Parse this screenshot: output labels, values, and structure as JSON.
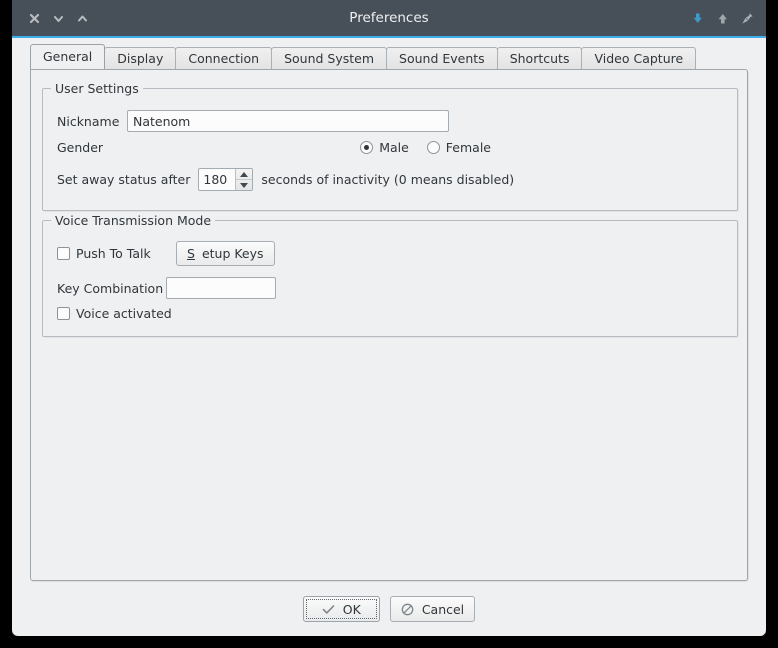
{
  "window": {
    "title": "Preferences",
    "accent_color": "#3daee9",
    "titlebar_color": "#475058",
    "background_color": "#eff0f1",
    "left_buttons": [
      {
        "name": "close-icon",
        "glyph": "x"
      },
      {
        "name": "minimize-icon",
        "glyph": "chevron-down"
      },
      {
        "name": "maximize-icon",
        "glyph": "chevron-up"
      }
    ],
    "right_buttons": [
      {
        "name": "keep-below-icon",
        "glyph": "arrow-down-badge"
      },
      {
        "name": "keep-above-icon",
        "glyph": "arrow-up-badge"
      },
      {
        "name": "pin-icon",
        "glyph": "pin"
      }
    ]
  },
  "tabs": [
    {
      "label": "General",
      "active": true
    },
    {
      "label": "Display",
      "active": false
    },
    {
      "label": "Connection",
      "active": false
    },
    {
      "label": "Sound System",
      "active": false
    },
    {
      "label": "Sound Events",
      "active": false
    },
    {
      "label": "Shortcuts",
      "active": false
    },
    {
      "label": "Video Capture",
      "active": false
    }
  ],
  "user_settings": {
    "group_title": "User Settings",
    "nickname_label": "Nickname",
    "nickname_value": "Natenom",
    "nickname_placeholder": "",
    "gender_label": "Gender",
    "gender_options": [
      {
        "label": "Male",
        "selected": true
      },
      {
        "label": "Female",
        "selected": false
      }
    ],
    "away_prefix_label": "Set away status after",
    "away_value": "180",
    "away_suffix_label": "seconds of inactivity (0 means disabled)"
  },
  "voice_settings": {
    "group_title": "Voice Transmission Mode",
    "push_to_talk_label": "Push To Talk",
    "push_to_talk_checked": false,
    "setup_keys_button": {
      "mnemonic": "S",
      "rest": "etup Keys"
    },
    "key_combination_label": "Key Combination",
    "key_combination_value": "",
    "key_combination_placeholder": "",
    "voice_activated_label": "Voice activated",
    "voice_activated_checked": false
  },
  "dialog_buttons": {
    "ok_label": "OK",
    "ok_icon": "check-icon",
    "cancel_label": "Cancel",
    "cancel_icon": "prohibited-icon"
  }
}
